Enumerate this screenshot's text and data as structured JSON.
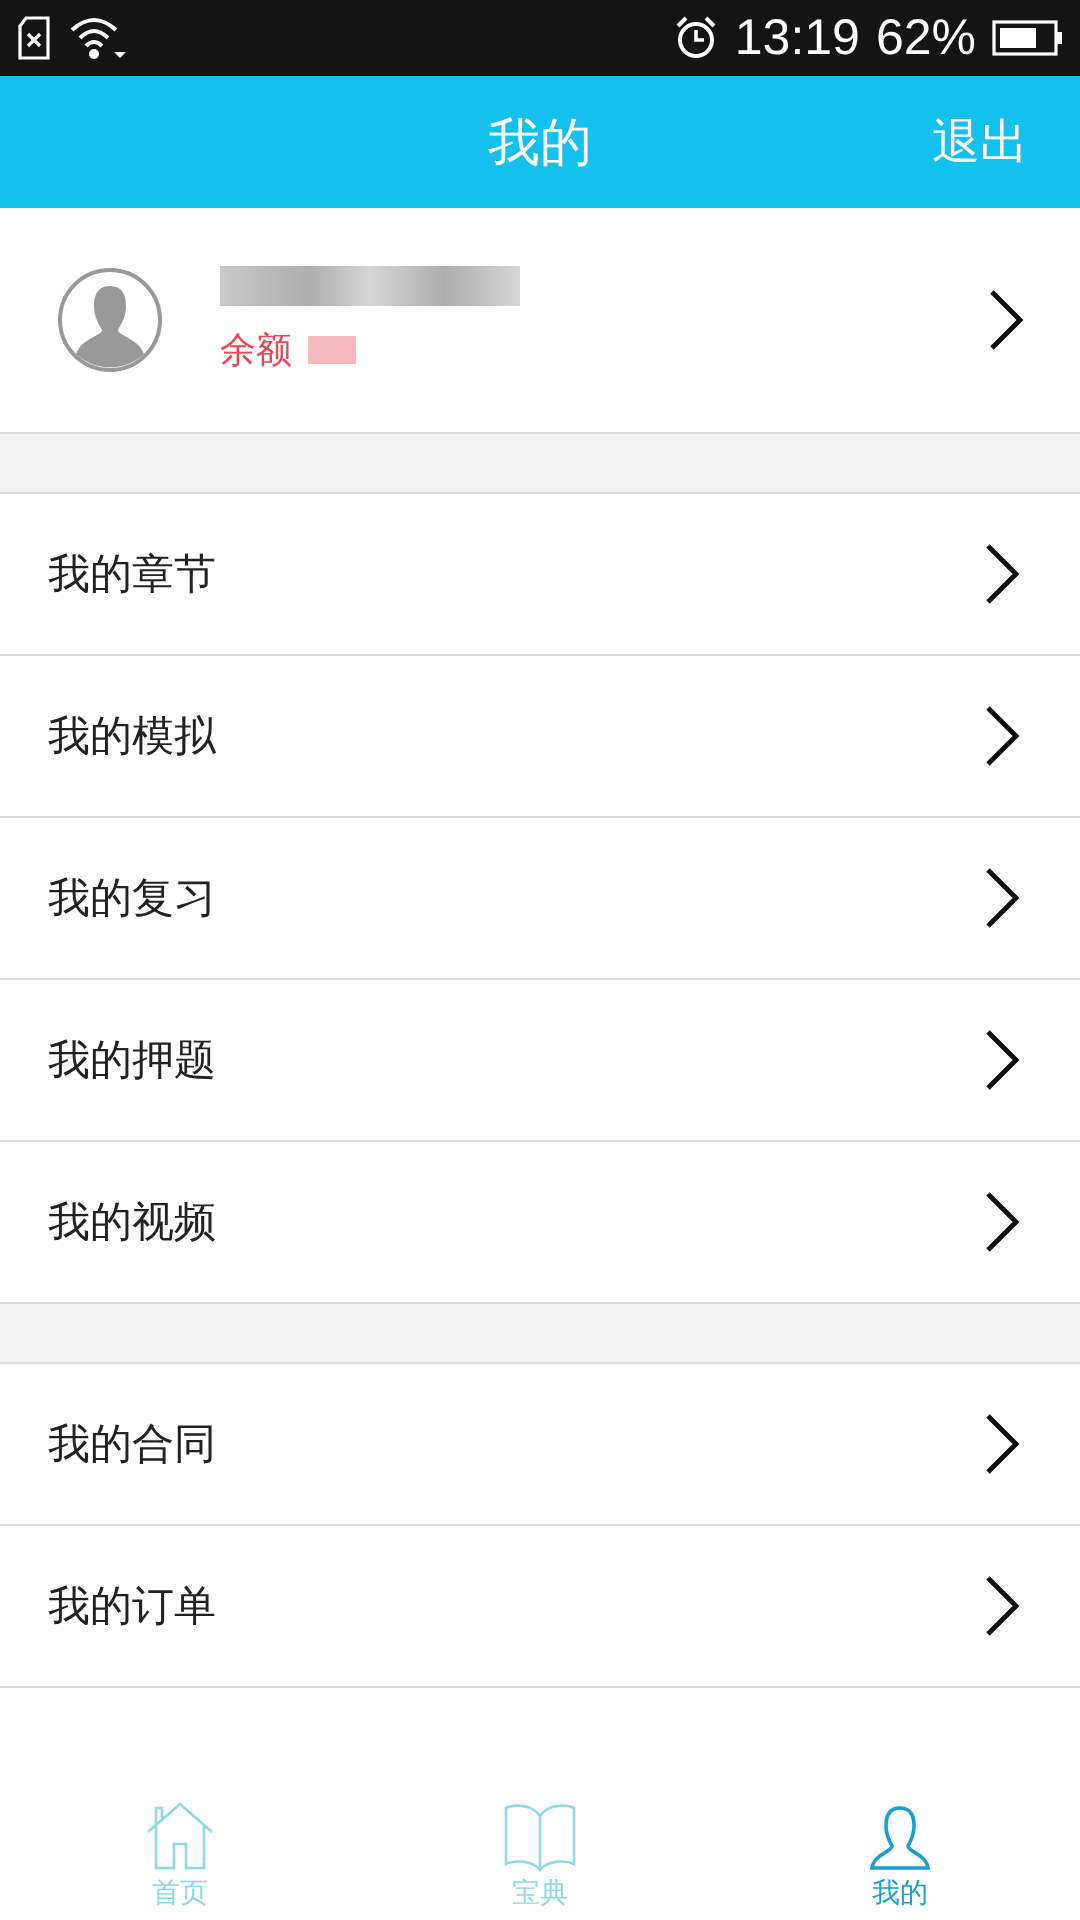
{
  "status_bar": {
    "time": "13:19",
    "battery_percent": "62%"
  },
  "header": {
    "title": "我的",
    "action": "退出"
  },
  "profile": {
    "balance_label": "余额"
  },
  "menu_groups": [
    [
      {
        "label": "我的章节"
      },
      {
        "label": "我的模拟"
      },
      {
        "label": "我的复习"
      },
      {
        "label": "我的押题"
      },
      {
        "label": "我的视频"
      }
    ],
    [
      {
        "label": "我的合同"
      },
      {
        "label": "我的订单"
      }
    ]
  ],
  "bottom_nav": [
    {
      "label": "首页",
      "kind": "home",
      "selected": false
    },
    {
      "label": "宝典",
      "kind": "book",
      "selected": false
    },
    {
      "label": "我的",
      "kind": "person",
      "selected": true
    }
  ]
}
